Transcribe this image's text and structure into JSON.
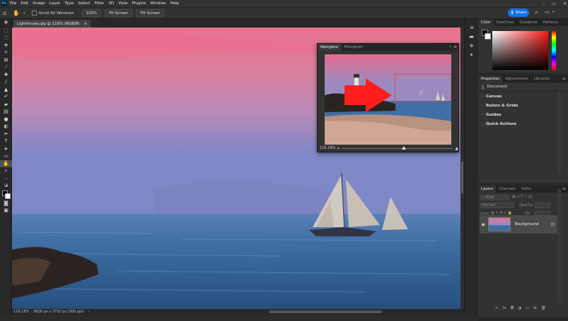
{
  "app": {
    "logo": "Ps"
  },
  "menu": [
    "File",
    "Edit",
    "Image",
    "Layer",
    "Type",
    "Select",
    "Filter",
    "3D",
    "View",
    "Plugins",
    "Window",
    "Help"
  ],
  "window_controls": [
    "–",
    "▭",
    "✕"
  ],
  "options": {
    "scroll_all_label": "Scroll All Windows",
    "zoom_value": "100%",
    "fit_screen": "Fit Screen",
    "fill_screen": "Fill Screen",
    "share": "Share"
  },
  "document": {
    "tab_title": "Lighthouse.jpg @ 116% (RGB/8)",
    "close": "×"
  },
  "status": {
    "zoom": "116.18%",
    "info": "5626 px x 3752 px (300 ppi)"
  },
  "navigator": {
    "tabs": [
      "Navigator",
      "Histogram"
    ],
    "zoom": "116.18%"
  },
  "color_panel": {
    "tabs": [
      "Color",
      "Swatches",
      "Gradients",
      "Patterns"
    ],
    "fg_color": "#000000",
    "bg_color": "#ffffff",
    "hue_color": "#ff1a1a"
  },
  "properties": {
    "tabs": [
      "Properties",
      "Adjustments",
      "Libraries"
    ],
    "doc_label": "Document",
    "sections": [
      "Canvas",
      "Rulers & Grids",
      "Guides",
      "Quick Actions"
    ]
  },
  "layers": {
    "tabs": [
      "Layers",
      "Channels",
      "Paths"
    ],
    "kind": "Kind",
    "blend": "Normal",
    "opacity_label": "Opacity:",
    "lock_label": "Lock:",
    "fill_label": "Fill:",
    "layer_name": "Background"
  },
  "colors": {
    "accent": "#1473e6",
    "red_arrow": "#ff1e1e"
  }
}
